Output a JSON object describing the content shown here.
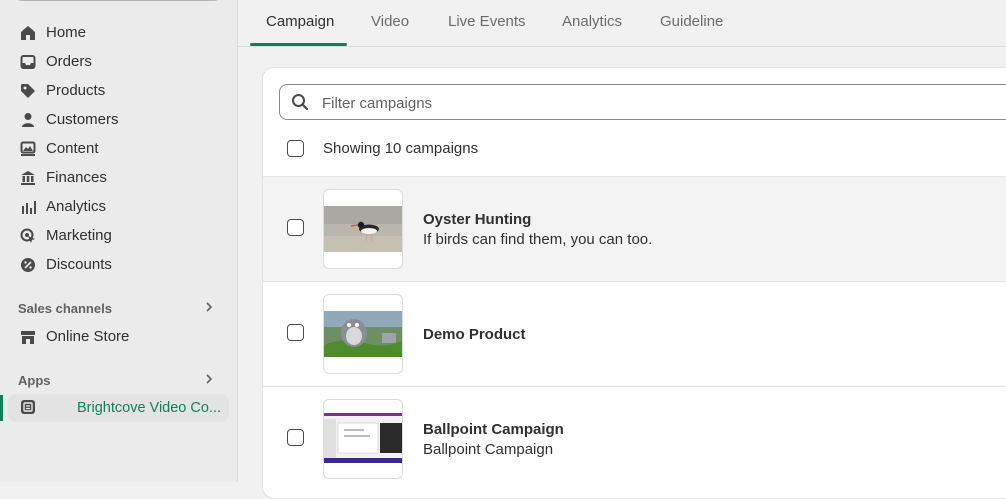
{
  "sidebar": {
    "items": [
      {
        "label": "Home",
        "icon": "home-icon"
      },
      {
        "label": "Orders",
        "icon": "inbox-icon"
      },
      {
        "label": "Products",
        "icon": "tag-icon"
      },
      {
        "label": "Customers",
        "icon": "person-icon"
      },
      {
        "label": "Content",
        "icon": "image-content-icon"
      },
      {
        "label": "Finances",
        "icon": "bank-icon"
      },
      {
        "label": "Analytics",
        "icon": "bar-chart-icon"
      },
      {
        "label": "Marketing",
        "icon": "target-icon"
      },
      {
        "label": "Discounts",
        "icon": "discount-icon"
      }
    ],
    "sales_channels": {
      "heading": "Sales channels",
      "items": [
        {
          "label": "Online Store",
          "icon": "store-icon"
        }
      ]
    },
    "apps": {
      "heading": "Apps",
      "items": [
        {
          "label": "Brightcove Video Co...",
          "icon": "app-icon"
        }
      ]
    }
  },
  "tabs": [
    {
      "label": "Campaign",
      "active": true
    },
    {
      "label": "Video",
      "active": false
    },
    {
      "label": "Live Events",
      "active": false
    },
    {
      "label": "Analytics",
      "active": false
    },
    {
      "label": "Guideline",
      "active": false
    }
  ],
  "filter": {
    "placeholder": "Filter campaigns"
  },
  "list": {
    "summary": "Showing 10 campaigns",
    "rows": [
      {
        "title": "Oyster Hunting",
        "subtitle": "If birds can find them, you can too.",
        "thumb": "bird-beach-thumbnail"
      },
      {
        "title": "Demo Product",
        "subtitle": "",
        "thumb": "animated-animal-thumbnail"
      },
      {
        "title": "Ballpoint Campaign",
        "subtitle": "Ballpoint Campaign",
        "thumb": "screen-capture-thumbnail"
      }
    ]
  },
  "colors": {
    "accent": "#10805a",
    "sidebar_bg": "#ebebeb",
    "page_bg": "#f1f1f1"
  }
}
